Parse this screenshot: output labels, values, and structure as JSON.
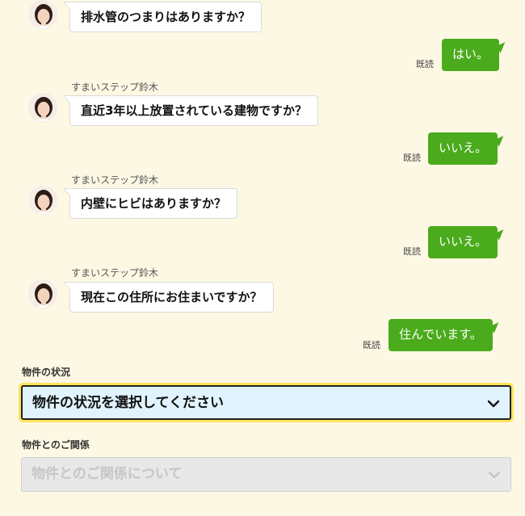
{
  "chat": {
    "sender_name": "すまいステップ鈴木",
    "read_label": "既読",
    "q1": "排水管のつまりはありますか？",
    "a1": "はい。",
    "q2": "直近3年以上放置されている建物ですか？",
    "a2": "いいえ。",
    "q3": "内壁にヒビはありますか？",
    "a3": "いいえ。",
    "q4": "現在この住所にお住まいですか？",
    "a4": "住んでいます。"
  },
  "form": {
    "property_status_label": "物件の状況",
    "property_status_placeholder": "物件の状況を選択してください",
    "relationship_label": "物件とのご関係",
    "relationship_placeholder": "物件とのご関係について"
  },
  "icons": {
    "avatar": "operator-avatar",
    "dropdown": "chevron-down-icon"
  },
  "colors": {
    "background": "#fdf8e4",
    "reply_bubble": "#4aab1c",
    "focus_ring": "#ffe45a",
    "select_active_bg": "#e0f3ff"
  }
}
